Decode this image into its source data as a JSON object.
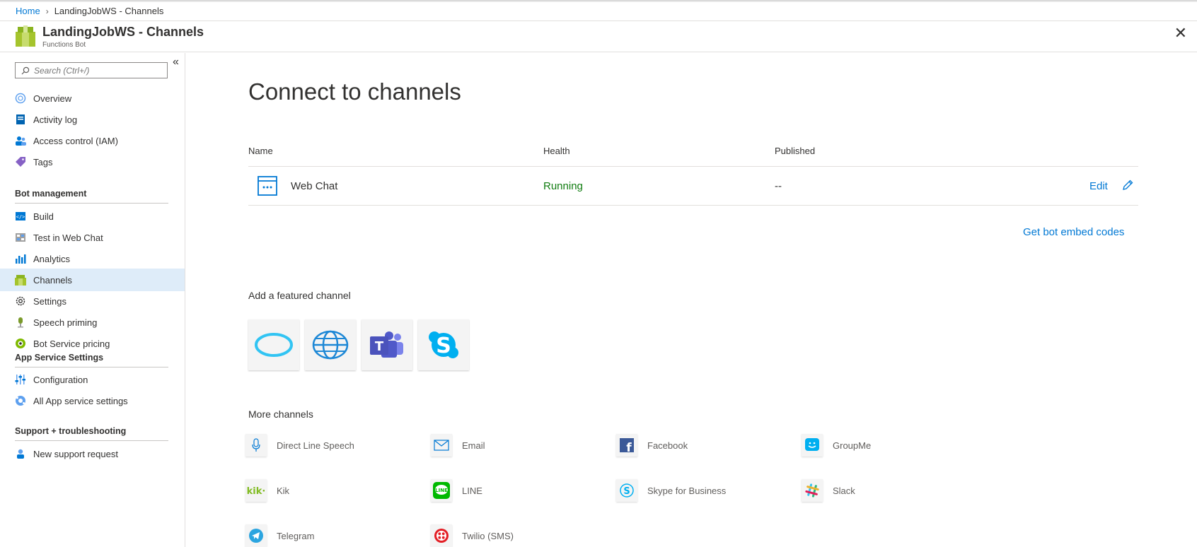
{
  "breadcrumb": {
    "home": "Home",
    "current": "LandingJobWS - Channels"
  },
  "header": {
    "title": "LandingJobWS - Channels",
    "subtitle": "Functions Bot"
  },
  "search": {
    "placeholder": "Search (Ctrl+/)"
  },
  "nav": {
    "overview": "Overview",
    "activity_log": "Activity log",
    "access_control": "Access control (IAM)",
    "tags": "Tags",
    "bot_management": "Bot management",
    "build": "Build",
    "test_web_chat": "Test in Web Chat",
    "analytics": "Analytics",
    "channels": "Channels",
    "settings": "Settings",
    "speech_priming": "Speech priming",
    "pricing": "Bot Service pricing",
    "app_service_settings": "App Service Settings",
    "configuration": "Configuration",
    "all_app_settings": "All App service settings",
    "support": "Support + troubleshooting",
    "new_support": "New support request"
  },
  "main": {
    "heading": "Connect to channels",
    "columns": {
      "name": "Name",
      "health": "Health",
      "published": "Published"
    },
    "row": {
      "name": "Web Chat",
      "health": "Running",
      "published": "--",
      "edit": "Edit"
    },
    "embed": "Get bot embed codes",
    "featured_heading": "Add a featured channel",
    "more_heading": "More channels",
    "channels": {
      "direct_line_speech": "Direct Line Speech",
      "email": "Email",
      "facebook": "Facebook",
      "groupme": "GroupMe",
      "kik": "Kik",
      "line": "LINE",
      "skype_business": "Skype for Business",
      "slack": "Slack",
      "telegram": "Telegram",
      "twilio": "Twilio (SMS)"
    }
  },
  "colors": {
    "accent": "#0078d4",
    "running": "#107c10",
    "active_nav": "#deecf9"
  }
}
